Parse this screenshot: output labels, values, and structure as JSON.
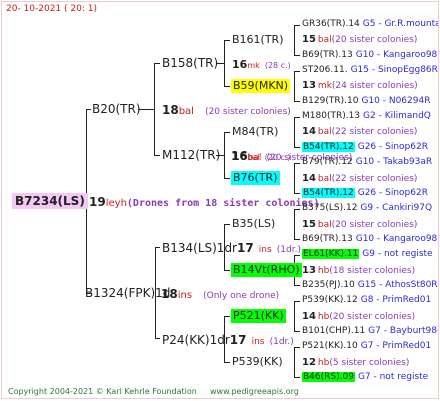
{
  "header_date": "20-  10-2021  (  20:   1)",
  "root": {
    "name": "B7234(LS)",
    "num": "19",
    "year": "ley",
    "suffix": "h",
    "note": "(Drones from 18 sister colonies)"
  },
  "gen1": [
    {
      "name": "B20(TR)",
      "num": "18",
      "year": "bal",
      "note": "(20 sister colonies)"
    },
    {
      "name": "B1324(FPK)1d",
      "num": "18",
      "year": "ins",
      "note": "(Only one drone)"
    }
  ],
  "gen2": [
    {
      "name": "B158(TR)"
    },
    {
      "name": "M112(TR)",
      "num": "16",
      "year": "bal",
      "note": "(20 sister colonies)"
    },
    {
      "name": "B134(LS)1dr",
      "num": "17",
      "year": "ins",
      "note": "(1dr.)"
    },
    {
      "name": "P24(KK)1dr",
      "num": "17",
      "year": "ins",
      "note": "(1dr.)"
    }
  ],
  "gen3": [
    {
      "name": "B161(TR)",
      "num": "16",
      "year": "mk",
      "note": "(28 c.)"
    },
    {
      "name": "B59(MKN)",
      "color": "#ffff00"
    },
    {
      "name": "M84(TR)",
      "num": "16",
      "year": "bal",
      "note": "(20 c.)"
    },
    {
      "name": "B76(TR)",
      "color": "#00ffff"
    },
    {
      "name": "B35(LS)",
      "num": "17",
      "year": "ins",
      "note": "(1dr.)"
    },
    {
      "name": "B14Vt(RHO)",
      "color": "#00ff00"
    },
    {
      "name": "P521(KK)",
      "color": "#00ff00",
      "num": "17",
      "year": "ins",
      "note": "(1dr.)"
    },
    {
      "name": "P539(KK)"
    }
  ],
  "gen4": [
    {
      "label": "GR36(TR).14",
      "info": "G5 - Gr.R.mounta"
    },
    {
      "num": "15",
      "year": "bal",
      "note": "(20 sister colonies)"
    },
    {
      "label": "B69(TR).13",
      "info": "G10 - Kangaroo98R"
    },
    {
      "label": "ST206.11.",
      "info": "G15 - SinopEgg86R"
    },
    {
      "num": "13",
      "year": "mk",
      "note": "(24 sister colonies)"
    },
    {
      "label": "B129(TR).10",
      "info": "G10 - N06294R"
    },
    {
      "label": "M180(TR).13",
      "info": "G2 - KilimandQ"
    },
    {
      "num": "14",
      "year": "bal",
      "note": "(22 sister colonies)"
    },
    {
      "label": "B54(TR).12",
      "info": "G26 - Sinop62R",
      "color": "#00ffff"
    },
    {
      "label": "B79(TR).12",
      "info": "G10 - Takab93aR"
    },
    {
      "num": "14",
      "year": "bal",
      "note": "(22 sister colonies)"
    },
    {
      "label": "B54(TR).12",
      "info": "G26 - Sinop62R",
      "color": "#00ffff"
    },
    {
      "label": "B375(LS).12",
      "info": "G9 - Cankiri97Q"
    },
    {
      "num": "15",
      "year": "bal",
      "note": "(20 sister colonies)"
    },
    {
      "label": "B69(TR).13",
      "info": "G10 - Kangaroo98R"
    },
    {
      "label": "EL61(KK).11",
      "info": "G9 - not registe",
      "color": "#00ff00"
    },
    {
      "num": "13",
      "year": "hb",
      "note": "(18 sister colonies)"
    },
    {
      "label": "B235(PJ).10",
      "info": "G15 - AthosSt80R"
    },
    {
      "label": "P539(KK).12",
      "info": "G8 - PrimRed01"
    },
    {
      "num": "14",
      "year": "hb",
      "note": "(20 sister colonies)"
    },
    {
      "label": "B101(CHP).11",
      "info": "G7 - Bayburt98-3"
    },
    {
      "label": "P521(KK).10",
      "info": "G7 - PrimRed01"
    },
    {
      "num": "12",
      "year": "hb",
      "note": "(5 sister colonies)"
    },
    {
      "label": "B46(RS).09",
      "info": "G7 - not registe",
      "color": "#00ff00"
    }
  ],
  "footer": {
    "copyright": "Copyright 2004-2021 © Karl Kehrle Foundation",
    "url": "www.pedigreeapis.org"
  }
}
